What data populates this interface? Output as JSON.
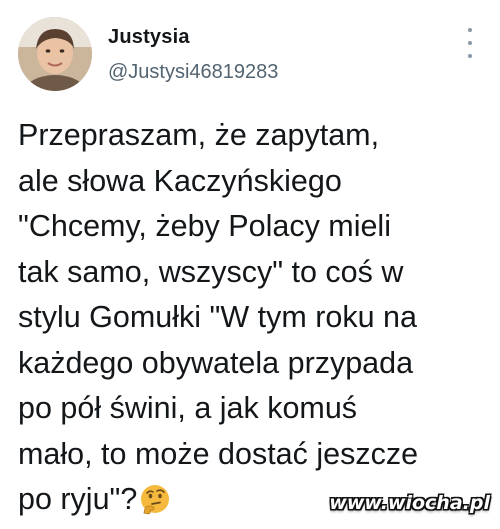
{
  "author": {
    "name": "Justysia",
    "handle": "@Justysi46819283"
  },
  "tweet": {
    "lines": [
      "Przepraszam, że zapytam,",
      "ale słowa Kaczyńskiego",
      "\"Chcemy, żeby Polacy mieli",
      "tak samo, wszyscy\" to coś w",
      "stylu Gomułki \"W tym roku na",
      "każdego obywatela przypada",
      "po pół świni, a jak komuś",
      "mało, to może dostać jeszcze",
      "po ryju\"?"
    ],
    "emoji": "thinking-face"
  },
  "watermark": "www.wiocha.pl",
  "icons": {
    "menu": "more-vertical-icon"
  },
  "colors": {
    "text": "#14171a",
    "handle": "#536471",
    "emoji": "#f4b93d"
  }
}
